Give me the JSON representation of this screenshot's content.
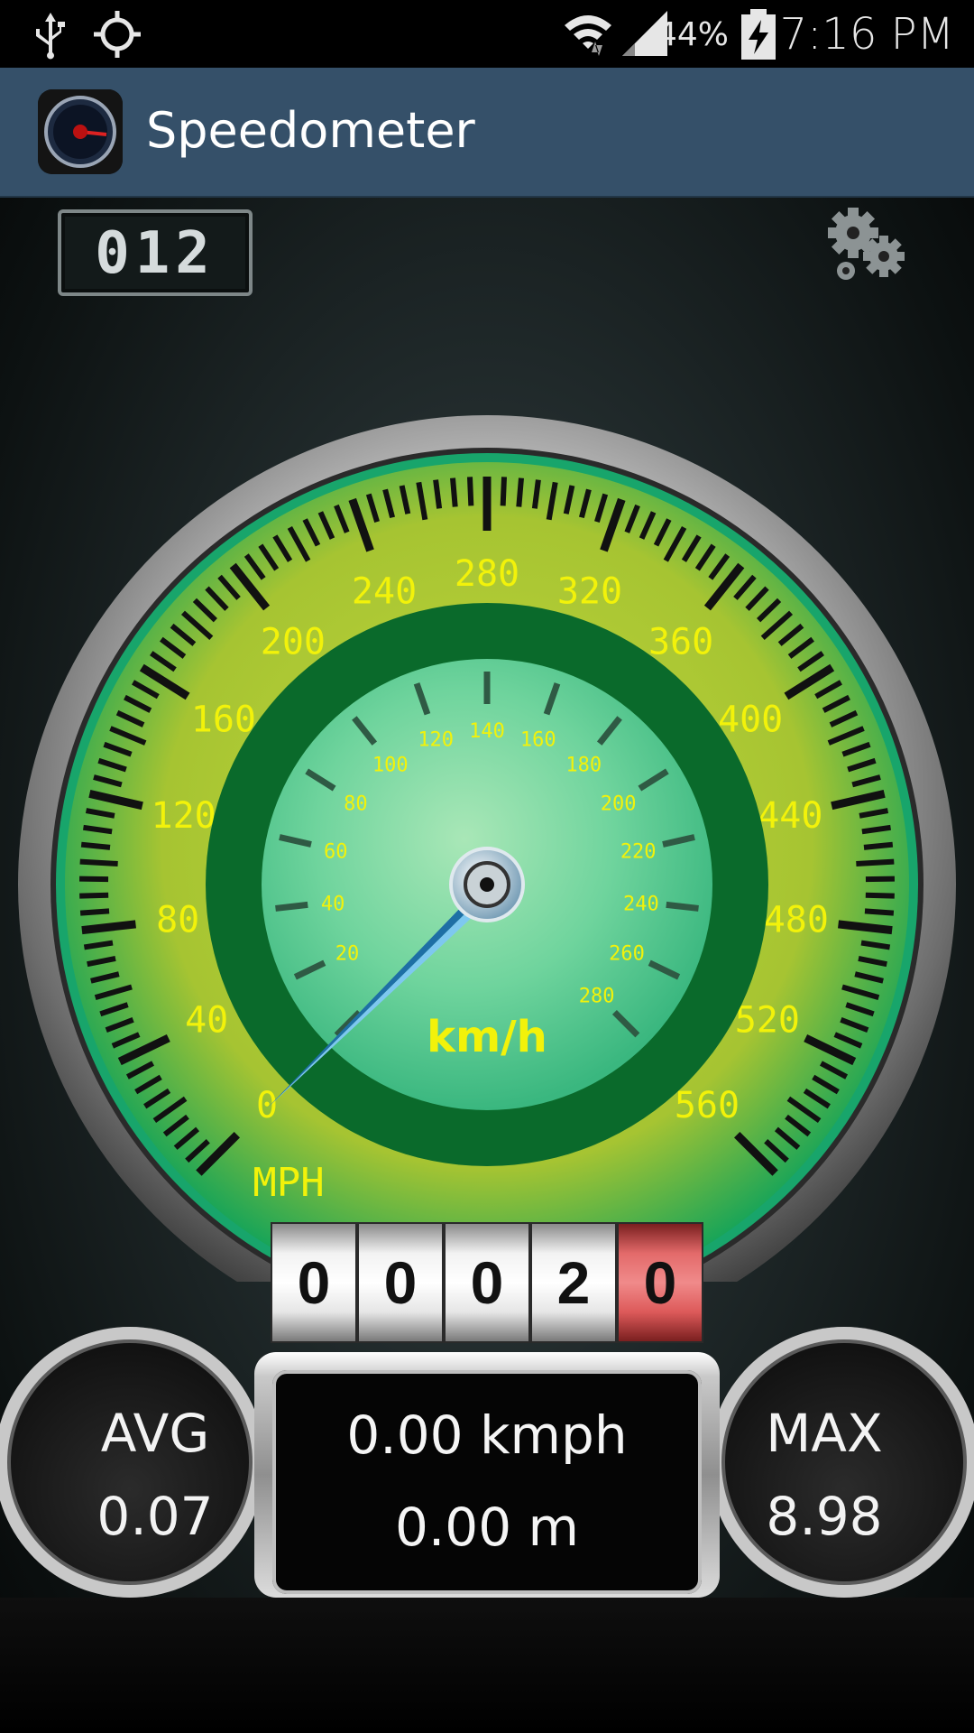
{
  "status_bar": {
    "time": "7:16 PM",
    "battery_percent": "44%",
    "icons": [
      "usb-icon",
      "gps-icon",
      "wifi-icon",
      "signal-icon",
      "battery-charging-icon"
    ]
  },
  "action_bar": {
    "title": "Speedometer",
    "icon": "speedometer-app-icon"
  },
  "trip_counter": {
    "value": "012"
  },
  "settings": {
    "icon": "gear-icon"
  },
  "gauge": {
    "outer_unit": "MPH",
    "inner_unit": "km/h",
    "outer_labels": [
      "0",
      "40",
      "80",
      "120",
      "160",
      "200",
      "240",
      "280",
      "320",
      "360",
      "400",
      "440",
      "480",
      "520",
      "560"
    ],
    "inner_labels": [
      "20",
      "40",
      "60",
      "80",
      "100",
      "120",
      "140",
      "160",
      "180",
      "200",
      "220",
      "240",
      "260",
      "280"
    ],
    "colors": {
      "outer_ring": "#9bbf2a",
      "inner_dial": "#6ed6a0",
      "label_color": "#f2f20a",
      "needle": "#7ec8f0"
    }
  },
  "odometer": {
    "digits": [
      "0",
      "0",
      "0",
      "2",
      "0"
    ]
  },
  "stats": {
    "avg_label": "AVG",
    "avg_value": "0.07",
    "max_label": "MAX",
    "max_value": "8.98",
    "current_speed": "0.00 kmph",
    "distance": "0.00 m"
  }
}
